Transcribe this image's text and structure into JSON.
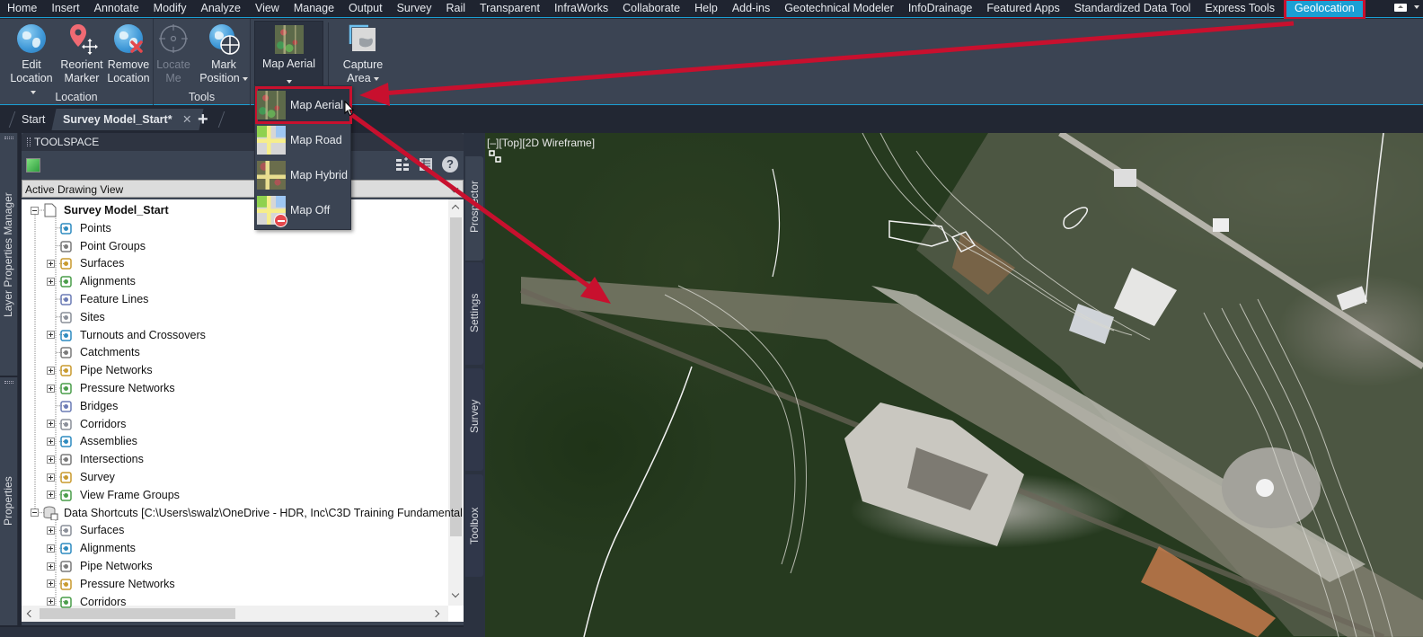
{
  "menu": {
    "tabs": [
      "Home",
      "Insert",
      "Annotate",
      "Modify",
      "Analyze",
      "View",
      "Manage",
      "Output",
      "Survey",
      "Rail",
      "Transparent",
      "InfraWorks",
      "Collaborate",
      "Help",
      "Add-ins",
      "Geotechnical Modeler",
      "InfoDrainage",
      "Featured Apps",
      "Standardized Data Tool",
      "Express Tools",
      "Geolocation"
    ],
    "active_tab": "Geolocation"
  },
  "ribbon": {
    "panels": {
      "location": {
        "label": "Location",
        "buttons": {
          "edit_location": {
            "line1": "Edit",
            "line2": "Location",
            "icon": "globe-icon",
            "has_dropdown": true
          },
          "reorient_marker": {
            "line1": "Reorient",
            "line2": "Marker",
            "icon": "map-pin-move-icon"
          },
          "remove_location": {
            "line1": "Remove",
            "line2": "Location",
            "icon": "globe-remove-icon"
          }
        }
      },
      "tools": {
        "label": "Tools",
        "buttons": {
          "locate_me": {
            "line1": "Locate",
            "line2": "Me",
            "icon": "crosshair-icon",
            "disabled": true
          },
          "mark_position": {
            "line1": "Mark",
            "line2": "Position",
            "icon": "globe-crosshair-icon",
            "has_dropdown": true
          }
        }
      },
      "map": {
        "button": {
          "label": "Map Aerial",
          "icon": "map-aerial-icon",
          "has_dropdown": true
        }
      },
      "capture": {
        "button": {
          "line1": "Capture",
          "line2": "Area",
          "icon": "capture-area-icon",
          "has_dropdown": true
        }
      }
    }
  },
  "map_dropdown": {
    "items": [
      {
        "label": "Map Aerial",
        "icon": "map-aerial-icon",
        "selected": true
      },
      {
        "label": "Map Road",
        "icon": "map-road-icon"
      },
      {
        "label": "Map Hybrid",
        "icon": "map-hybrid-icon"
      },
      {
        "label": "Map Off",
        "icon": "map-off-icon"
      }
    ]
  },
  "file_tabs": {
    "tabs": [
      {
        "label": "Start"
      },
      {
        "label": "Survey Model_Start*",
        "active": true
      }
    ],
    "new_tab": "+"
  },
  "side_palettes": {
    "layer_properties": "Layer Properties Manager",
    "properties": "Properties"
  },
  "toolspace": {
    "title": "TOOLSPACE",
    "view_selector": "Active Drawing View",
    "tree": [
      {
        "label": "Survey Model_Start",
        "level": 0,
        "expander": "minus",
        "bold": true,
        "icon": "drawing-icon"
      },
      {
        "label": "Points",
        "level": 1,
        "icon": "points-icon"
      },
      {
        "label": "Point Groups",
        "level": 1,
        "icon": "point-groups-icon"
      },
      {
        "label": "Surfaces",
        "level": 1,
        "expander": "plus",
        "icon": "surfaces-icon"
      },
      {
        "label": "Alignments",
        "level": 1,
        "expander": "plus",
        "icon": "alignments-icon"
      },
      {
        "label": "Feature Lines",
        "level": 1,
        "icon": "feature-lines-icon"
      },
      {
        "label": "Sites",
        "level": 1,
        "icon": "sites-icon"
      },
      {
        "label": "Turnouts and Crossovers",
        "level": 1,
        "expander": "plus",
        "icon": "turnouts-icon"
      },
      {
        "label": "Catchments",
        "level": 1,
        "icon": "catchments-icon"
      },
      {
        "label": "Pipe Networks",
        "level": 1,
        "expander": "plus",
        "icon": "pipe-networks-icon"
      },
      {
        "label": "Pressure Networks",
        "level": 1,
        "expander": "plus",
        "icon": "pressure-networks-icon"
      },
      {
        "label": "Bridges",
        "level": 1,
        "icon": "bridges-icon"
      },
      {
        "label": "Corridors",
        "level": 1,
        "expander": "plus",
        "icon": "corridors-icon"
      },
      {
        "label": "Assemblies",
        "level": 1,
        "expander": "plus",
        "icon": "assemblies-icon"
      },
      {
        "label": "Intersections",
        "level": 1,
        "expander": "plus",
        "icon": "intersections-icon"
      },
      {
        "label": "Survey",
        "level": 1,
        "expander": "plus",
        "icon": "survey-icon"
      },
      {
        "label": "View Frame Groups",
        "level": 1,
        "expander": "plus",
        "icon": "view-frame-groups-icon"
      },
      {
        "label": "Data Shortcuts [C:\\Users\\swalz\\OneDrive - HDR, Inc\\C3D Training Fundamental...",
        "level": 0,
        "expander": "minus",
        "icon": "data-shortcuts-icon"
      },
      {
        "label": "Surfaces",
        "level": 1,
        "expander": "plus",
        "icon": "ds-surfaces-icon"
      },
      {
        "label": "Alignments",
        "level": 1,
        "expander": "plus",
        "icon": "ds-alignments-icon"
      },
      {
        "label": "Pipe Networks",
        "level": 1,
        "expander": "plus",
        "icon": "ds-pipe-networks-icon"
      },
      {
        "label": "Pressure Networks",
        "level": 1,
        "expander": "plus",
        "icon": "ds-pressure-networks-icon"
      },
      {
        "label": "Corridors",
        "level": 1,
        "expander": "plus",
        "icon": "ds-corridors-icon"
      }
    ],
    "side_tabs": [
      "Prospector",
      "Settings",
      "Survey",
      "Toolbox"
    ]
  },
  "viewport": {
    "label": "[–][Top][2D Wireframe]"
  },
  "colors": {
    "accent": "#1a9fd4",
    "annotation_red": "#c8102e",
    "ribbon_bg": "#3b4453",
    "menubar_bg": "#1f2430"
  }
}
